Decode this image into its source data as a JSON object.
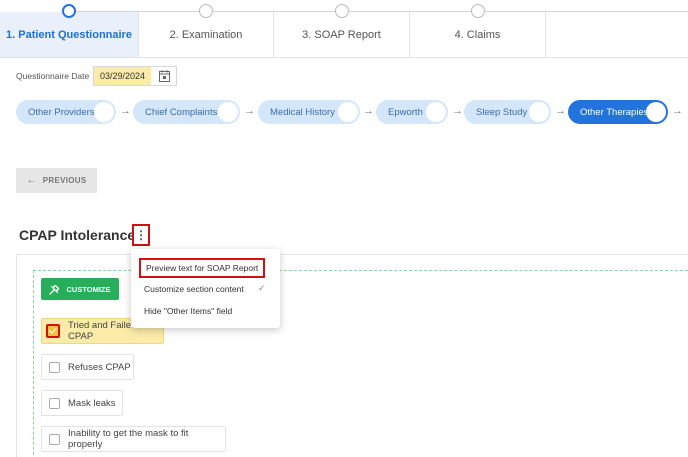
{
  "steps": {
    "tabs": [
      {
        "label": "1. Patient Questionnaire",
        "active": true
      },
      {
        "label": "2. Examination",
        "active": false
      },
      {
        "label": "3. SOAP Report",
        "active": false
      },
      {
        "label": "4. Claims",
        "active": false
      }
    ]
  },
  "questionnaire": {
    "date_label": "Questionnaire Date",
    "date_value": "03/29/2024"
  },
  "sections": [
    {
      "label": "Other Providers",
      "active": false
    },
    {
      "label": "Chief Complaints",
      "active": false
    },
    {
      "label": "Medical History",
      "active": false
    },
    {
      "label": "Epworth",
      "active": false
    },
    {
      "label": "Sleep Study",
      "active": false
    },
    {
      "label": "Other Therapies",
      "active": true
    }
  ],
  "nav": {
    "previous_label": "PREVIOUS"
  },
  "section": {
    "title": "CPAP Intolerance",
    "kebab": "⋮",
    "customize_label": "CUSTOMIZE",
    "options": [
      {
        "label": "Tried and Failed CPAP",
        "checked": true
      },
      {
        "label": "Refuses CPAP",
        "checked": false
      },
      {
        "label": "Mask leaks",
        "checked": false
      },
      {
        "label": "Inability to get the mask to fit properly",
        "checked": false
      }
    ]
  },
  "menu": {
    "items": [
      {
        "label": "Preview text for SOAP Report",
        "highlighted": true
      },
      {
        "label": "Customize section content",
        "checked": true
      },
      {
        "label": "Hide \"Other Items\" field",
        "highlighted": false
      }
    ],
    "check_glyph": "✓"
  },
  "icons": {
    "arrow": "→",
    "back_arrow": "←",
    "calendar": "calendar-icon",
    "customize": "wrench-icon"
  },
  "colors": {
    "primary": "#2273dc",
    "active_tab_bg": "#e9f0fb",
    "pill_bg": "#d4e6f9",
    "date_highlight": "#fbeba8",
    "customize_green": "#27ae5a",
    "annotation_red": "#d01111"
  }
}
